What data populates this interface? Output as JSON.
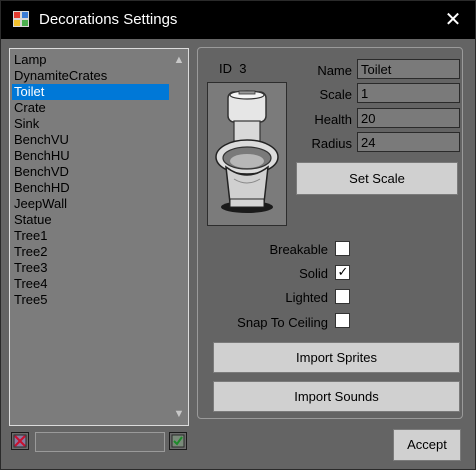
{
  "window": {
    "title": "Decorations Settings",
    "close_glyph": "✕"
  },
  "list": {
    "items": [
      "Lamp",
      "DynamiteCrates",
      "Toilet",
      "Crate",
      "Sink",
      "BenchVU",
      "BenchHU",
      "BenchVD",
      "BenchHD",
      "JeepWall",
      "Statue",
      "Tree1",
      "Tree2",
      "Tree3",
      "Tree4",
      "Tree5"
    ],
    "selected_index": 2
  },
  "details": {
    "id_label": "ID",
    "id_value": "3",
    "fields": {
      "name_label": "Name",
      "name_value": "Toilet",
      "scale_label": "Scale",
      "scale_value": "1",
      "health_label": "Health",
      "health_value": "20",
      "radius_label": "Radius",
      "radius_value": "24"
    },
    "set_scale_label": "Set Scale",
    "checkboxes": {
      "breakable_label": "Breakable",
      "breakable_checked": false,
      "solid_label": "Solid",
      "solid_checked": true,
      "lighted_label": "Lighted",
      "lighted_checked": false,
      "snap_label": "Snap To Ceiling",
      "snap_checked": false
    },
    "import_sprites_label": "Import Sprites",
    "import_sounds_label": "Import Sounds"
  },
  "footer": {
    "accept_label": "Accept",
    "filter_value": ""
  },
  "colors": {
    "selection": "#0078d7",
    "window_bg": "#646464",
    "titlebar": "#000000"
  }
}
